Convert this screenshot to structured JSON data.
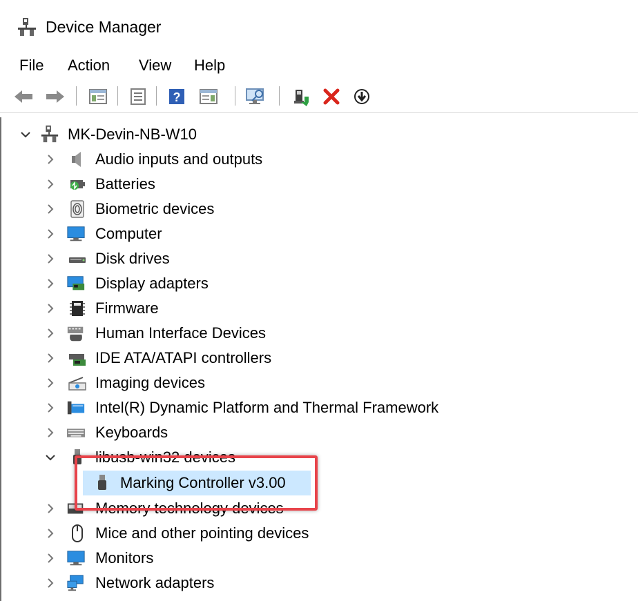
{
  "window": {
    "title": "Device Manager",
    "icon": "device-manager-icon"
  },
  "menu": {
    "items": [
      "File",
      "Action",
      "View",
      "Help"
    ]
  },
  "toolbar": {
    "buttons": [
      "back-arrow-icon",
      "forward-arrow-icon",
      "show-hide-console-tree-icon",
      "properties-icon",
      "help-icon",
      "action-pane-icon",
      "scan-hardware-icon",
      "update-driver-icon",
      "uninstall-x-icon",
      "disable-device-icon"
    ]
  },
  "tree": {
    "root": "MK-Devin-NB-W10",
    "categories": [
      "Audio inputs and outputs",
      "Batteries",
      "Biometric devices",
      "Computer",
      "Disk drives",
      "Display adapters",
      "Firmware",
      "Human Interface Devices",
      "IDE ATA/ATAPI controllers",
      "Imaging devices",
      "Intel(R) Dynamic Platform and Thermal Framework",
      "Keyboards",
      "libusb-win32 devices",
      "Memory technology devices",
      "Mice and other pointing devices",
      "Monitors",
      "Network adapters"
    ],
    "expanded_child": "Marking Controller v3.00"
  },
  "colors": {
    "selection": "#cce8ff",
    "highlight": "#e8434a",
    "uninstall_red": "#d9261c"
  }
}
